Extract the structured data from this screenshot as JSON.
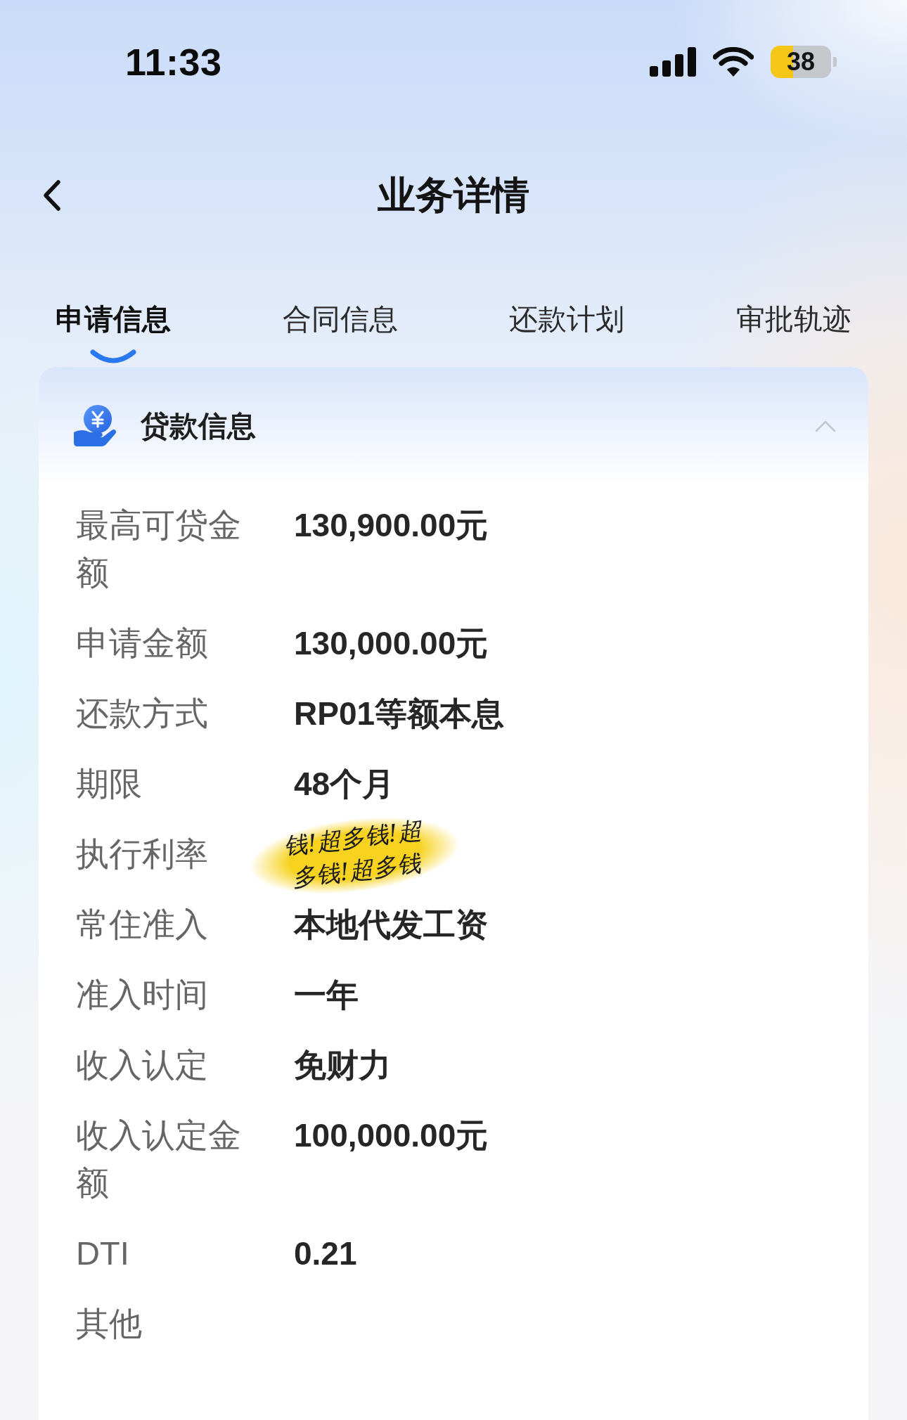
{
  "status_bar": {
    "time": "11:33",
    "battery": "38"
  },
  "nav": {
    "title": "业务详情"
  },
  "tabs": [
    {
      "label": "申请信息",
      "selected": true
    },
    {
      "label": "合同信息",
      "selected": false
    },
    {
      "label": "还款计划",
      "selected": false
    },
    {
      "label": "审批轨迹",
      "selected": false
    }
  ],
  "section": {
    "title": "贷款信息",
    "expanded": true,
    "rows": [
      {
        "kind": "text",
        "label": "最高可贷金额",
        "value": "130,900.00元"
      },
      {
        "kind": "text",
        "label": "申请金额",
        "value": "130,000.00元"
      },
      {
        "kind": "text",
        "label": "还款方式",
        "value": "RP01等额本息"
      },
      {
        "kind": "text",
        "label": "期限",
        "value": "48个月"
      },
      {
        "kind": "sticker",
        "label": "执行利率",
        "sticker": [
          "钱!超多钱!超",
          "多钱!超多钱"
        ]
      },
      {
        "kind": "text",
        "label": "常住准入",
        "value": "本地代发工资"
      },
      {
        "kind": "text",
        "label": "准入时间",
        "value": "一年"
      },
      {
        "kind": "text",
        "label": "收入认定",
        "value": "免财力"
      },
      {
        "kind": "text",
        "label": "收入认定金额",
        "value": "100,000.00元"
      },
      {
        "kind": "text",
        "label": "DTI",
        "value": "0.21"
      },
      {
        "kind": "text",
        "label": "其他"
      }
    ]
  }
}
